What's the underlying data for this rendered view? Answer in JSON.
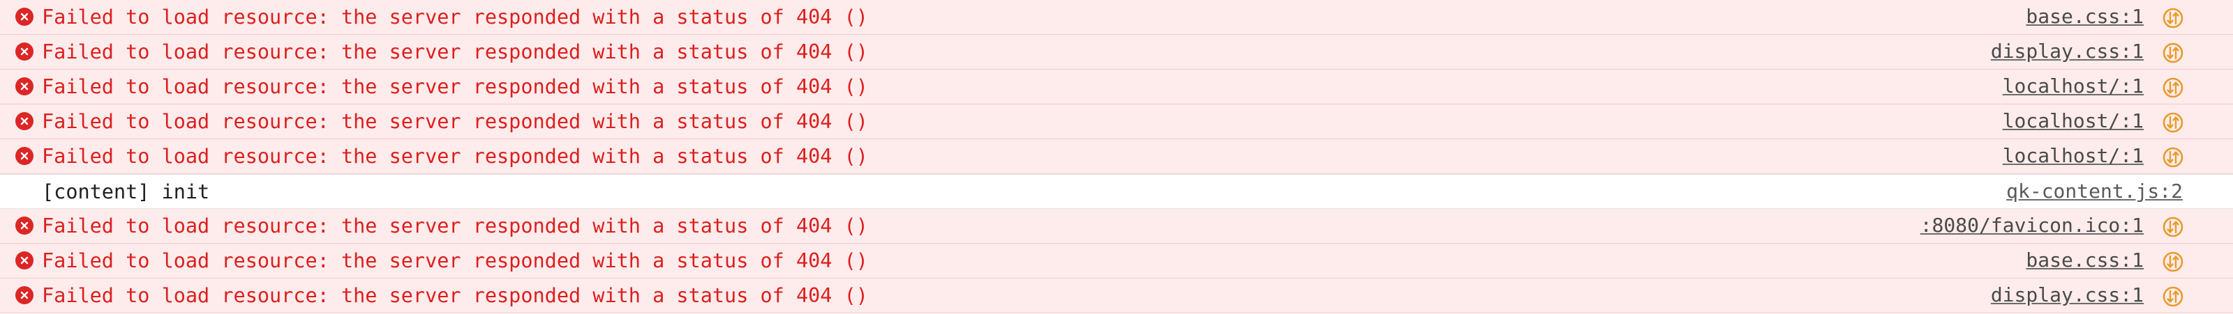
{
  "colors": {
    "error_bg": "#fdeceb",
    "error_text": "#dc1f1f",
    "error_icon": "#dc2626",
    "network_icon": "#e79b2c",
    "link_text": "#4a4a4a"
  },
  "icons": {
    "error": "error-x-circle-icon",
    "network": "network-request-icon"
  },
  "console": {
    "entries": [
      {
        "level": "error",
        "message": "Failed to load resource: the server responded with a status of 404 ()",
        "source": "base.css:1"
      },
      {
        "level": "error",
        "message": "Failed to load resource: the server responded with a status of 404 ()",
        "source": "display.css:1"
      },
      {
        "level": "error",
        "message": "Failed to load resource: the server responded with a status of 404 ()",
        "source": "localhost/:1"
      },
      {
        "level": "error",
        "message": "Failed to load resource: the server responded with a status of 404 ()",
        "source": "localhost/:1"
      },
      {
        "level": "error",
        "message": "Failed to load resource: the server responded with a status of 404 ()",
        "source": "localhost/:1"
      },
      {
        "level": "log",
        "message": "[content] init",
        "source": "qk-content.js:2"
      },
      {
        "level": "error",
        "message": "Failed to load resource: the server responded with a status of 404 ()",
        "source": ":8080/favicon.ico:1"
      },
      {
        "level": "error",
        "message": "Failed to load resource: the server responded with a status of 404 ()",
        "source": "base.css:1"
      },
      {
        "level": "error",
        "message": "Failed to load resource: the server responded with a status of 404 ()",
        "source": "display.css:1"
      }
    ]
  }
}
